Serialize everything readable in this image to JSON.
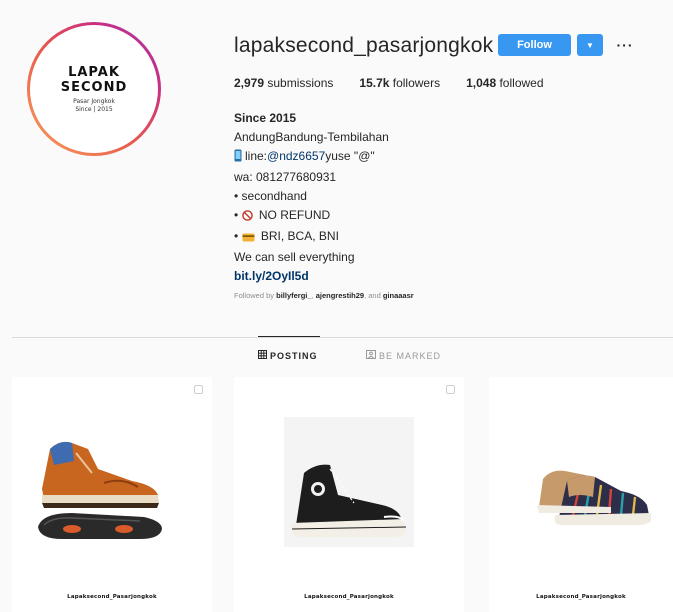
{
  "profile": {
    "avatar": {
      "line1": "LAPAK",
      "line2": "SECOND",
      "sub1": "Pasar Jongkok",
      "sub2": "Since | 2015"
    },
    "username": "lapaksecond_pasarjongkok",
    "follow_label": "Follow",
    "more_icon": "more-options-icon",
    "stats": [
      {
        "count": "2,979",
        "label": " submissions"
      },
      {
        "count": "15.7k",
        "label": " followers"
      },
      {
        "count": "1,048",
        "label": " followed"
      }
    ],
    "bio": {
      "name": "Since 2015",
      "location": "AndungBandung-Tembilahan",
      "line_prefix": "line:",
      "line_handle": "@ndz6657",
      "line_suffix": "yuse \"@\"",
      "wa": "wa: 081277680931",
      "bullet1": "• secondhand",
      "bullet2_prefix": "• ",
      "bullet2": " NO REFUND",
      "bullet3_prefix": "• ",
      "bullet3": " BRI, BCA, BNI",
      "tagline": "We can sell everything",
      "link": "bit.ly/2OyIl5d"
    },
    "followed_by": {
      "prefix": "Followed by ",
      "user1": "billyfergi_",
      "sep1": ", ",
      "user2": "ajengrestih29",
      "sep2": ", and ",
      "user3": "ginaaasr"
    }
  },
  "tabs": [
    {
      "label": "POSTING",
      "icon": "grid-icon",
      "active": true
    },
    {
      "label": "BE MARKED",
      "icon": "tagged-icon",
      "active": false
    }
  ],
  "posts": [
    {
      "caption": "Lapaksecond_Pasarjongkok",
      "product": "orange hiking boot",
      "multi": true
    },
    {
      "caption": "Lapaksecond_Pasarjongkok",
      "product": "black high-top canvas sneaker",
      "multi": true
    },
    {
      "caption": "Lapaksecond_Pasarjongkok",
      "product": "striped low-top sneaker",
      "multi": false
    }
  ],
  "colors": {
    "follow_button": "#3897f0",
    "link": "#003569",
    "muted": "#8e8e8e"
  }
}
